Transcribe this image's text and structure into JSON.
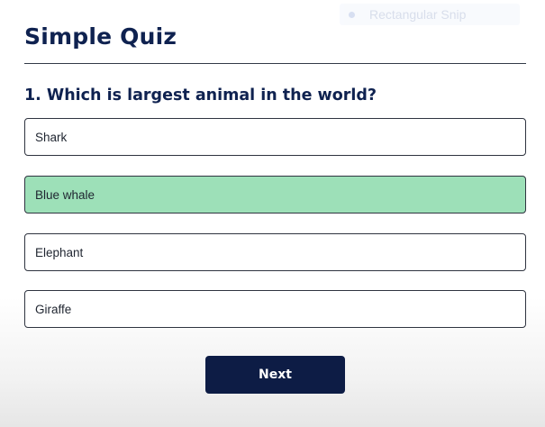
{
  "overlay": {
    "snip_label": "Rectangular Snip"
  },
  "quiz": {
    "title": "Simple Quiz",
    "question": "1. Which is largest animal in the world?",
    "answers": [
      {
        "label": "Shark",
        "state": "default"
      },
      {
        "label": "Blue whale",
        "state": "correct"
      },
      {
        "label": "Elephant",
        "state": "default"
      },
      {
        "label": "Giraffe",
        "state": "default"
      }
    ],
    "next_label": "Next"
  },
  "colors": {
    "title_text": "#0f2250",
    "correct_answer_bg": "#9de0b8",
    "next_button_bg": "#0d1c45",
    "answer_border": "#2f3440"
  }
}
